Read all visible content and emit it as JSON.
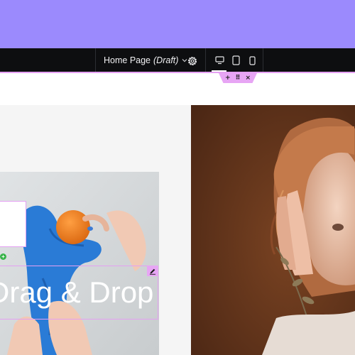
{
  "editor": {
    "page_name": "Home Page",
    "page_status": "(Draft)",
    "icons": {
      "chevron": "chevron-down-icon",
      "settings": "gear-icon",
      "desktop": "desktop-icon",
      "tablet": "tablet-icon",
      "mobile": "mobile-icon"
    },
    "active_device": "desktop",
    "colors": {
      "banner": "#9b8afd",
      "topbar": "#0d0e10",
      "selection": "#e4a0f2",
      "add": "#38b44a"
    }
  },
  "section_handle": {
    "add": "+",
    "drag": "⠿",
    "close": "×"
  },
  "canvas": {
    "heading": "Drag & Drop",
    "add_button": "+"
  }
}
